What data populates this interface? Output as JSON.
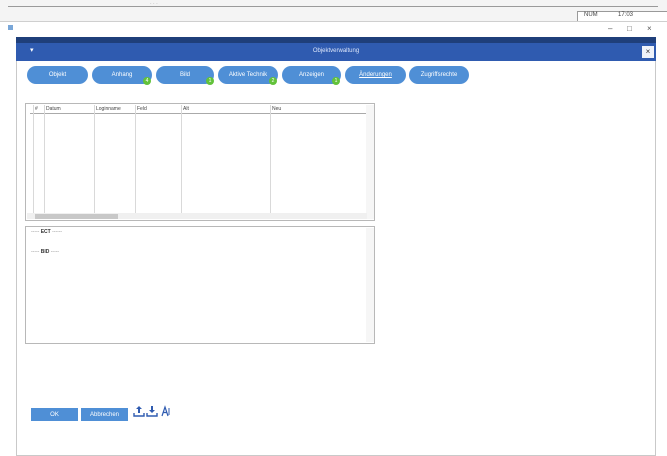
{
  "taskbar": {
    "dots": "· · ·",
    "lang": "NUM",
    "time": "17:03"
  },
  "window_controls": {
    "minimize": "–",
    "maximize": "□",
    "close": "×"
  },
  "dialog": {
    "menu_icon": "▾",
    "title": "Objektverwaltung",
    "close": "×"
  },
  "tabs": [
    {
      "label": "Objekt",
      "badge": ""
    },
    {
      "label": "Anhang",
      "badge": "4"
    },
    {
      "label": "Bild",
      "badge": "1"
    },
    {
      "label": "Aktive Technik",
      "badge": "2"
    },
    {
      "label": "Anzeigen",
      "badge": "1"
    },
    {
      "label": "Änderungen",
      "badge": ""
    },
    {
      "label": "Zugriffsrechte",
      "badge": ""
    }
  ],
  "table": {
    "columns": [
      "#",
      "Datum",
      "Loginname",
      "Feld",
      "Alt",
      "Neu"
    ]
  },
  "log": {
    "lines": [
      {
        "pre": "-----",
        "mid": "ECT",
        "post": "------"
      },
      {
        "pre": "-----",
        "mid": "BID",
        "post": "-----"
      }
    ]
  },
  "footer": {
    "ok_label": "OK",
    "cancel_label": "Abbrechen"
  },
  "icons": {
    "upload": "upload-icon",
    "download": "download-icon",
    "font": "font-size-icon"
  },
  "colors": {
    "accent": "#4f8fd6",
    "title_bar": "#2f5bb0",
    "badge": "#62c23a"
  }
}
